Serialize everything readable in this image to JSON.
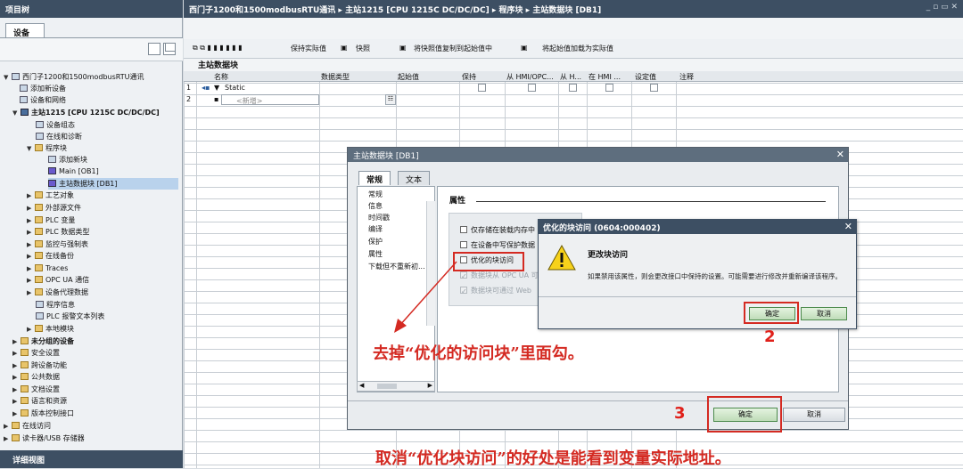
{
  "project_panel": {
    "title": "项目树",
    "tab": "设备",
    "bottom_title": "详细视图",
    "tree": [
      {
        "label": "西门子1200和1500modbusRTU通讯",
        "icon": "project"
      },
      {
        "label": "添加新设备",
        "icon": "add"
      },
      {
        "label": "设备和网络",
        "icon": "network"
      },
      {
        "label": "主站1215 [CPU 1215C DC/DC/DC]",
        "icon": "cpu"
      },
      {
        "label": "设备组态",
        "icon": "device"
      },
      {
        "label": "在线和诊断",
        "icon": "diag"
      },
      {
        "label": "程序块",
        "icon": "folder"
      },
      {
        "label": "添加新块",
        "icon": "add"
      },
      {
        "label": "Main [OB1]",
        "icon": "block"
      },
      {
        "label": "主站数据块 [DB1]",
        "icon": "block"
      },
      {
        "label": "工艺对象",
        "icon": "folder"
      },
      {
        "label": "外部源文件",
        "icon": "folder"
      },
      {
        "label": "PLC 变量",
        "icon": "folder"
      },
      {
        "label": "PLC 数据类型",
        "icon": "folder"
      },
      {
        "label": "监控与强制表",
        "icon": "folder"
      },
      {
        "label": "在线备份",
        "icon": "folder"
      },
      {
        "label": "Traces",
        "icon": "folder"
      },
      {
        "label": "OPC UA 通信",
        "icon": "folder"
      },
      {
        "label": "设备代理数据",
        "icon": "folder"
      },
      {
        "label": "程序信息",
        "icon": "info"
      },
      {
        "label": "PLC 报警文本列表",
        "icon": "list"
      },
      {
        "label": "本地模块",
        "icon": "folder"
      },
      {
        "label": "未分组的设备",
        "icon": "folder"
      },
      {
        "label": "安全设置",
        "icon": "folder"
      },
      {
        "label": "跨设备功能",
        "icon": "folder"
      },
      {
        "label": "公共数据",
        "icon": "folder"
      },
      {
        "label": "文档设置",
        "icon": "folder"
      },
      {
        "label": "语言和资源",
        "icon": "folder"
      },
      {
        "label": "版本控制接口",
        "icon": "folder"
      },
      {
        "label": "在线访问",
        "icon": "folder"
      },
      {
        "label": "读卡器/USB 存储器",
        "icon": "folder"
      }
    ]
  },
  "editor": {
    "breadcrumb": [
      "西门子1200和1500modbusRTU通讯",
      "主站1215 [CPU 1215C DC/DC/DC]",
      "程序块",
      "主站数据块 [DB1]"
    ],
    "toolbar": {
      "keep_actual": "保持实际值",
      "snapshot": "快照",
      "copy_snapshot": "将快照值复制到起始值中",
      "load_start": "将起始值加载为实际值"
    },
    "db_title": "主站数据块",
    "columns": [
      "名称",
      "数据类型",
      "起始值",
      "保持",
      "从 HMI/OPC...",
      "从 H...",
      "在 HMI ...",
      "设定值",
      "注释"
    ],
    "rows": [
      {
        "num": "1",
        "name": "Static"
      },
      {
        "num": "2",
        "name": "<新增>"
      }
    ]
  },
  "properties_dialog": {
    "title": "主站数据块 [DB1]",
    "tabs": [
      "常规",
      "文本"
    ],
    "nav": [
      "常规",
      "信息",
      "时间戳",
      "编译",
      "保护",
      "属性",
      "下载但不重新初..."
    ],
    "section": "属性",
    "options": [
      {
        "label": "仅存储在装载内存中",
        "checked": false,
        "disabled": false
      },
      {
        "label": "在设备中写保护数据",
        "checked": false,
        "disabled": false
      },
      {
        "label": "优化的块访问",
        "checked": false,
        "disabled": false
      },
      {
        "label": "数据块从 OPC UA 可",
        "checked": true,
        "disabled": true
      },
      {
        "label": "数据块可通过 Web",
        "checked": true,
        "disabled": true
      }
    ],
    "ok": "确定",
    "cancel": "取消"
  },
  "confirm_popup": {
    "title": "优化的块访问 (0604:000402)",
    "heading": "更改块访问",
    "message": "如果禁用该属性，则会更改接口中保持的设置。可能需要进行修改并重新编译该程序。",
    "ok": "确定",
    "cancel": "取消"
  },
  "annotations": {
    "step2": "2",
    "step3": "3",
    "note1": "去掉“优化的访问块”里面勾。",
    "note2": "取消“优化块访问”的好处是能看到变量实际地址。",
    "color": "#d42a22"
  }
}
